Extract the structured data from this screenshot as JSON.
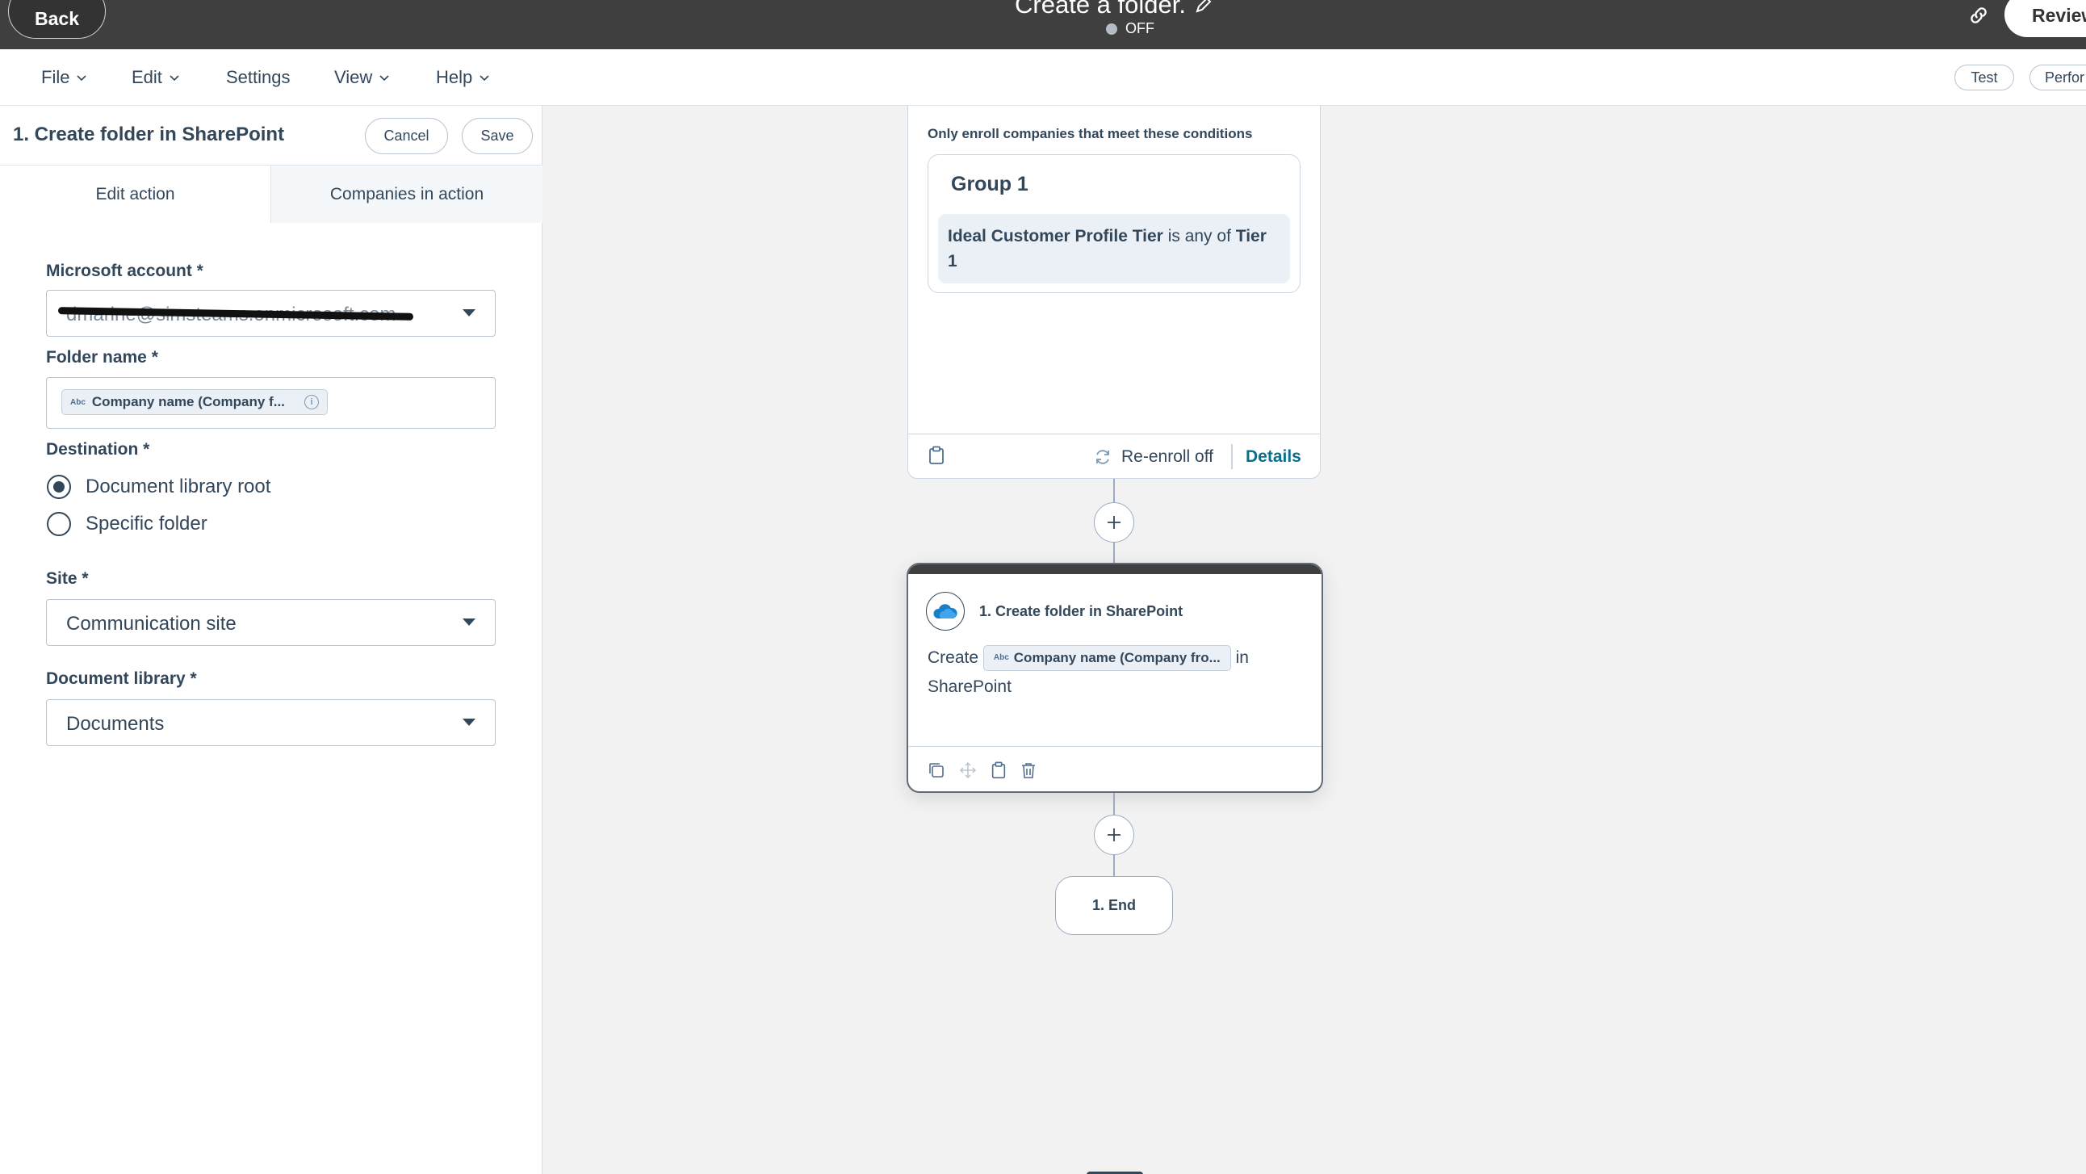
{
  "topbar": {
    "back_label": "Back",
    "workflow_title": "Create a folder.",
    "status_text": "OFF",
    "review_label": "Review"
  },
  "menubar": {
    "file": "File",
    "edit": "Edit",
    "settings": "Settings",
    "view": "View",
    "help": "Help",
    "test_label": "Test",
    "performance_label": "Perfor"
  },
  "panel": {
    "title": "1. Create folder in SharePoint",
    "cancel_label": "Cancel",
    "save_label": "Save",
    "tabs": [
      "Edit action",
      "Companies in action"
    ],
    "microsoft_account_label": "Microsoft account *",
    "microsoft_account_value": "dmarine@simsteams.onmicrosoft.com",
    "folder_name_label": "Folder name *",
    "folder_name_token": "Company name (Company f...",
    "token_type": "Abc",
    "destination_label": "Destination *",
    "destination_options": [
      "Document library root",
      "Specific folder"
    ],
    "site_label": "Site *",
    "site_value": "Communication site",
    "document_library_label": "Document library *",
    "document_library_value": "Documents"
  },
  "trigger_card": {
    "enroll_text": "Only enroll companies that meet these conditions",
    "group_title": "Group 1",
    "condition_property": "Ideal Customer Profile Tier",
    "condition_operator": "is any of",
    "condition_value": "Tier 1",
    "reenroll_label": "Re-enroll off",
    "details_label": "Details"
  },
  "action_card": {
    "title": "1. Create folder in SharePoint",
    "body_prefix": "Create",
    "body_token": "Company name (Company fro...",
    "body_suffix": "in",
    "body_line2": "SharePoint"
  },
  "end_node": {
    "label": "1. End"
  }
}
